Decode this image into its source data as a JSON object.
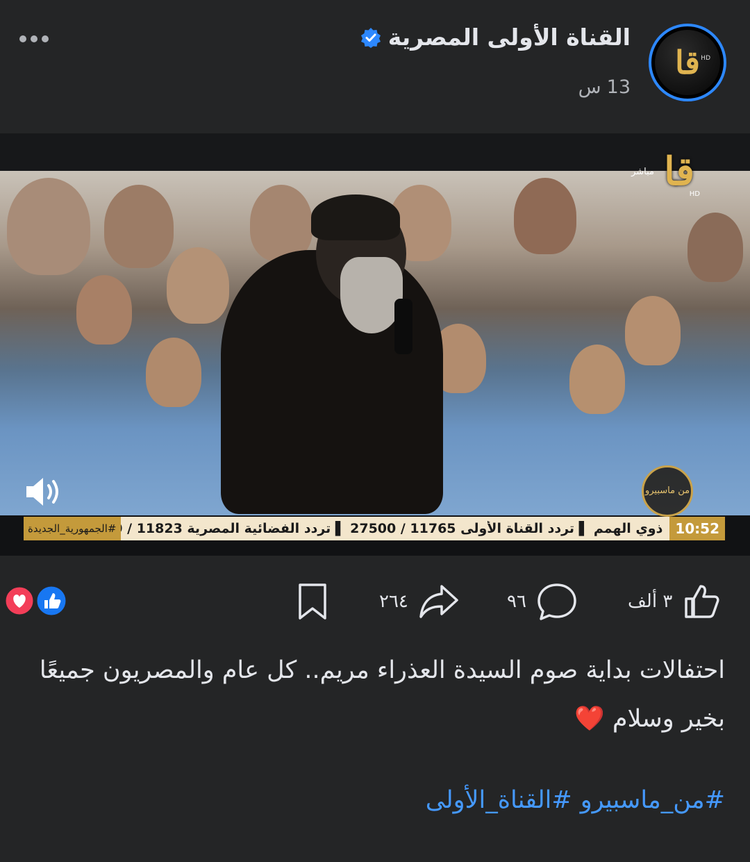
{
  "post": {
    "page_name": "القناة الأولى المصرية",
    "timestamp_value": "13",
    "timestamp_unit": "س",
    "more_label": "•••"
  },
  "video": {
    "channel_logo": "قا",
    "channel_live": "مباشر",
    "channel_hd": "HD",
    "show_badge": "من ماسبيرو",
    "ticker_time": "10:52",
    "ticker_text": "ذوي الهمم  ▌ تردد القناة الأولى 11765 / 27500  ▌ تردد الفضائية المصرية 11823 / 0",
    "ticker_tag": "#الجمهورية_الجديدة"
  },
  "actions": {
    "like_count": "٣ ألف",
    "comment_count": "٩٦",
    "share_count": "٢٦٤"
  },
  "caption": {
    "text": "احتفالات بداية صوم السيدة العذراء مريم.. كل عام والمصريون جميعًا بخير وسلام ❤️"
  },
  "hashtags": [
    "#من_ماسبيرو",
    "#القناة_الأولى"
  ],
  "colors": {
    "background": "#242526",
    "accent": "#2d88ff",
    "hashtag": "#4599ff",
    "love": "#f33e58",
    "like": "#1877f2"
  }
}
